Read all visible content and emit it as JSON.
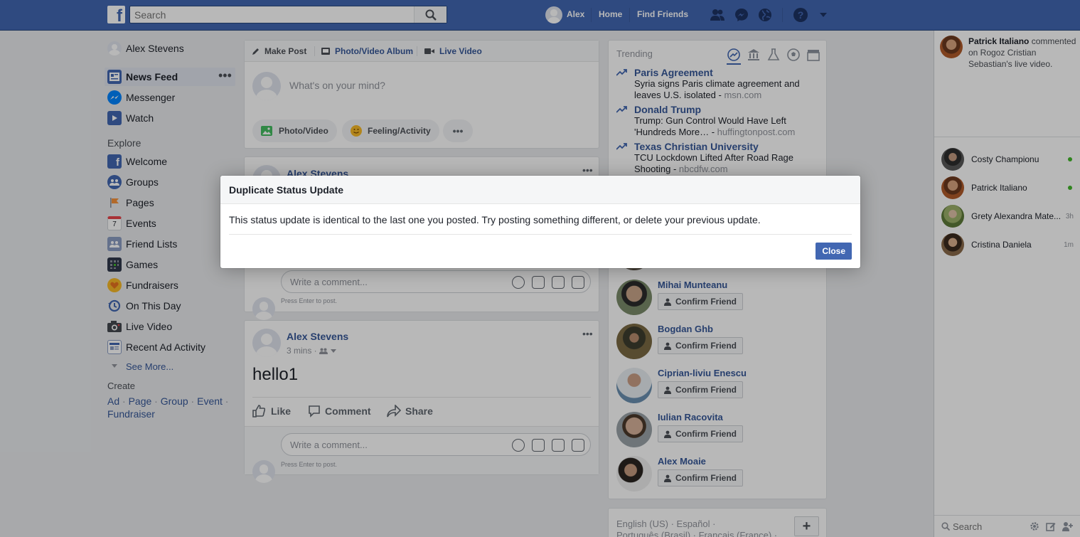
{
  "topbar": {
    "logo_letter": "f",
    "search_placeholder": "Search",
    "user_name": "Alex",
    "home_label": "Home",
    "find_friends_label": "Find Friends"
  },
  "left_nav": {
    "profile_name": "Alex Stevens",
    "main_items": [
      {
        "label": "News Feed",
        "icon": "news-feed-icon"
      },
      {
        "label": "Messenger",
        "icon": "messenger-icon"
      },
      {
        "label": "Watch",
        "icon": "watch-icon"
      }
    ],
    "explore_heading": "Explore",
    "explore_items": [
      {
        "label": "Welcome",
        "icon": "facebook-icon"
      },
      {
        "label": "Groups",
        "icon": "groups-icon"
      },
      {
        "label": "Pages",
        "icon": "pages-flag-icon"
      },
      {
        "label": "Events",
        "icon": "calendar-icon",
        "badge": "7"
      },
      {
        "label": "Friend Lists",
        "icon": "friend-lists-icon"
      },
      {
        "label": "Games",
        "icon": "games-icon"
      },
      {
        "label": "Fundraisers",
        "icon": "fundraisers-icon"
      },
      {
        "label": "On This Day",
        "icon": "on-this-day-icon"
      },
      {
        "label": "Live Video",
        "icon": "live-video-icon"
      },
      {
        "label": "Recent Ad Activity",
        "icon": "ad-activity-icon"
      }
    ],
    "see_more": "See More...",
    "create_heading": "Create",
    "create_links": [
      "Ad",
      "Page",
      "Group",
      "Event",
      "Fundraiser"
    ]
  },
  "composer": {
    "tabs": [
      "Make Post",
      "Photo/Video Album",
      "Live Video"
    ],
    "placeholder": "What's on your mind?",
    "actions": [
      "Photo/Video",
      "Feeling/Activity"
    ]
  },
  "post1": {
    "author": "Alex Stevens",
    "comment_placeholder": "Write a comment...",
    "hint": "Press Enter to post."
  },
  "post2": {
    "author": "Alex Stevens",
    "time": "3 mins",
    "text": "hello1",
    "actions": [
      "Like",
      "Comment",
      "Share"
    ],
    "comment_placeholder": "Write a comment...",
    "hint": "Press Enter to post."
  },
  "trending": {
    "heading": "Trending",
    "items": [
      {
        "topic": "Paris Agreement",
        "text": "Syria signs Paris climate agreement and leaves U.S. isolated",
        "source": "msn.com"
      },
      {
        "topic": "Donald Trump",
        "text": "Trump: Gun Control Would Have Left 'Hundreds More…",
        "source": "huffingtonpost.com"
      },
      {
        "topic": "Texas Christian University",
        "text": "TCU Lockdown Lifted After Road Rage Shooting",
        "source": "nbcdfw.com"
      }
    ]
  },
  "pymk": {
    "confirm_label": "Confirm Friend",
    "people": [
      "Mihai Munteanu",
      "Bogdan Ghb",
      "Ciprian-liviu Enescu",
      "Iulian Racovita",
      "Alex Moaie"
    ]
  },
  "footer": {
    "languages_line1": "English (US) · Español ·",
    "languages_line2": "Português (Brasil) · Français (France) ·",
    "add_label": "+"
  },
  "chat": {
    "ticker": {
      "actor": "Patrick Italiano",
      "text": " commented on Rogoz Cristian Sebastian's live video."
    },
    "contacts": [
      {
        "name": "Costy Championu",
        "status": "online"
      },
      {
        "name": "Patrick Italiano",
        "status": "online"
      },
      {
        "name": "Grety Alexandra Mate...",
        "status": "3h"
      },
      {
        "name": "Cristina Daniela",
        "status": "1m"
      }
    ],
    "search_placeholder": "Search"
  },
  "dialog": {
    "title": "Duplicate Status Update",
    "body": "This status update is identical to the last one you posted. Try posting something different, or delete your previous update.",
    "close_label": "Close"
  },
  "colors": {
    "brand": "#4267b2",
    "link": "#365899",
    "online": "#42b72a"
  }
}
